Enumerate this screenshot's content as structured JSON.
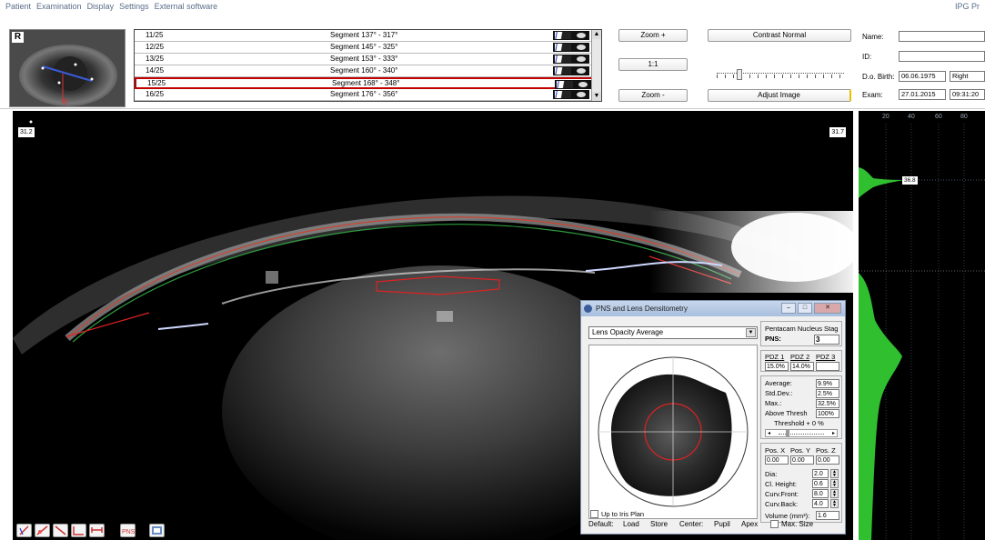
{
  "menu": {
    "items": [
      "Patient",
      "Examination",
      "Display",
      "Settings",
      "External software"
    ],
    "right_label": "IPG  Pr"
  },
  "eye_badge": "R",
  "segments": {
    "rows": [
      {
        "id": "11/25",
        "label": "Segment 137° - 317°",
        "selected": false
      },
      {
        "id": "12/25",
        "label": "Segment 145° - 325°",
        "selected": false
      },
      {
        "id": "13/25",
        "label": "Segment 153° - 333°",
        "selected": false
      },
      {
        "id": "14/25",
        "label": "Segment 160° - 340°",
        "selected": false
      },
      {
        "id": "15/25",
        "label": "Segment 168° - 348°",
        "selected": true
      },
      {
        "id": "16/25",
        "label": "Segment 176° - 356°",
        "selected": false
      }
    ]
  },
  "zoom": {
    "zoom_in": "Zoom +",
    "one_to_one": "1:1",
    "zoom_out": "Zoom -"
  },
  "contrast": {
    "normal_label": "Contrast Normal",
    "adjust_label": "Adjust Image"
  },
  "patient": {
    "name_label": "Name:",
    "name_value": "",
    "id_label": "ID:",
    "id_value": "",
    "dob_label": "D.o. Birth:",
    "dob_value": "06.06.1975",
    "eye_value": "Right",
    "exam_label": "Exam:",
    "exam_date": "27.01.2015",
    "exam_time": "09:31:20"
  },
  "image": {
    "corner_left": "31.2",
    "corner_right": "31.7"
  },
  "densitometry": {
    "title": "PNS and Lens Densitometry",
    "dropdown_value": "Lens Opacity Average",
    "up_to_iris_label": "Up to Iris Plan",
    "pentacam_label": "Pentacam Nucleus Stag",
    "pns_label": "PNS:",
    "pns_value": "3",
    "pdz_headers": [
      "PDZ 1",
      "PDZ 2",
      "PDZ 3"
    ],
    "pdz_values": [
      "15.0%",
      "14.0%",
      ""
    ],
    "average_label": "Average:",
    "average_value": "9.9%",
    "stddev_label": "Std.Dev.:",
    "stddev_value": "2.5%",
    "max_label": "Max.:",
    "max_value": "32.5%",
    "above_label": "Above Thresh",
    "above_value": "100%",
    "threshold_label": "Threshold + 0 %",
    "pos_headers": [
      "Pos. X",
      "Pos. Y",
      "Pos. Z"
    ],
    "pos_values": [
      "0.00",
      "0.00",
      "0.00"
    ],
    "dia_label": "Dia:",
    "dia_value": "2.0",
    "cyl_label": "Cl. Height:",
    "cyl_value": "0.6",
    "curv_front_label": "Curv.Front:",
    "curv_front_value": "8.0",
    "curv_back_label": "Curv.Back:",
    "curv_back_value": "4.0",
    "volume_label": "Volume (mm³):",
    "volume_value": "1.6",
    "footer": {
      "default": "Default:",
      "load": "Load",
      "store": "Store",
      "center": "Center:",
      "pupil": "Pupil",
      "apex": "Apex",
      "max_size": "Max. Size"
    }
  },
  "profile": {
    "ticks": [
      "20",
      "40",
      "60",
      "80"
    ],
    "marker_label": "36.8"
  },
  "colors": {
    "accent_red": "#c00000",
    "profile_green": "#2fbf2f",
    "titlebar": "#b3c7e3"
  }
}
